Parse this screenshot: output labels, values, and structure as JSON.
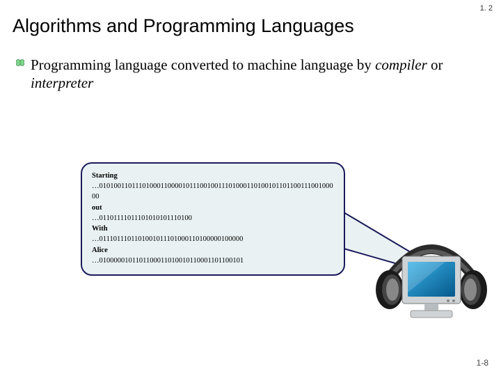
{
  "header_number": "1. 2",
  "title": "Algorithms and Programming Languages",
  "bullet": {
    "text_pre": "Programming language converted to machine language by ",
    "compiler": "compiler",
    "or": " or ",
    "interpreter": "interpreter"
  },
  "callout": {
    "label1": "Starting",
    "bin1": "…0101001101110100011000010111001001110100011010010110110011100100000",
    "label2": "out",
    "bin2": "…01101111011101010101110100",
    "label3": "With",
    "bin3": "…0111011101101001011101000110100000100000",
    "label4": "Alice",
    "bin4": "…0100000101101100011010010110001101100101"
  },
  "footer": "1-8"
}
